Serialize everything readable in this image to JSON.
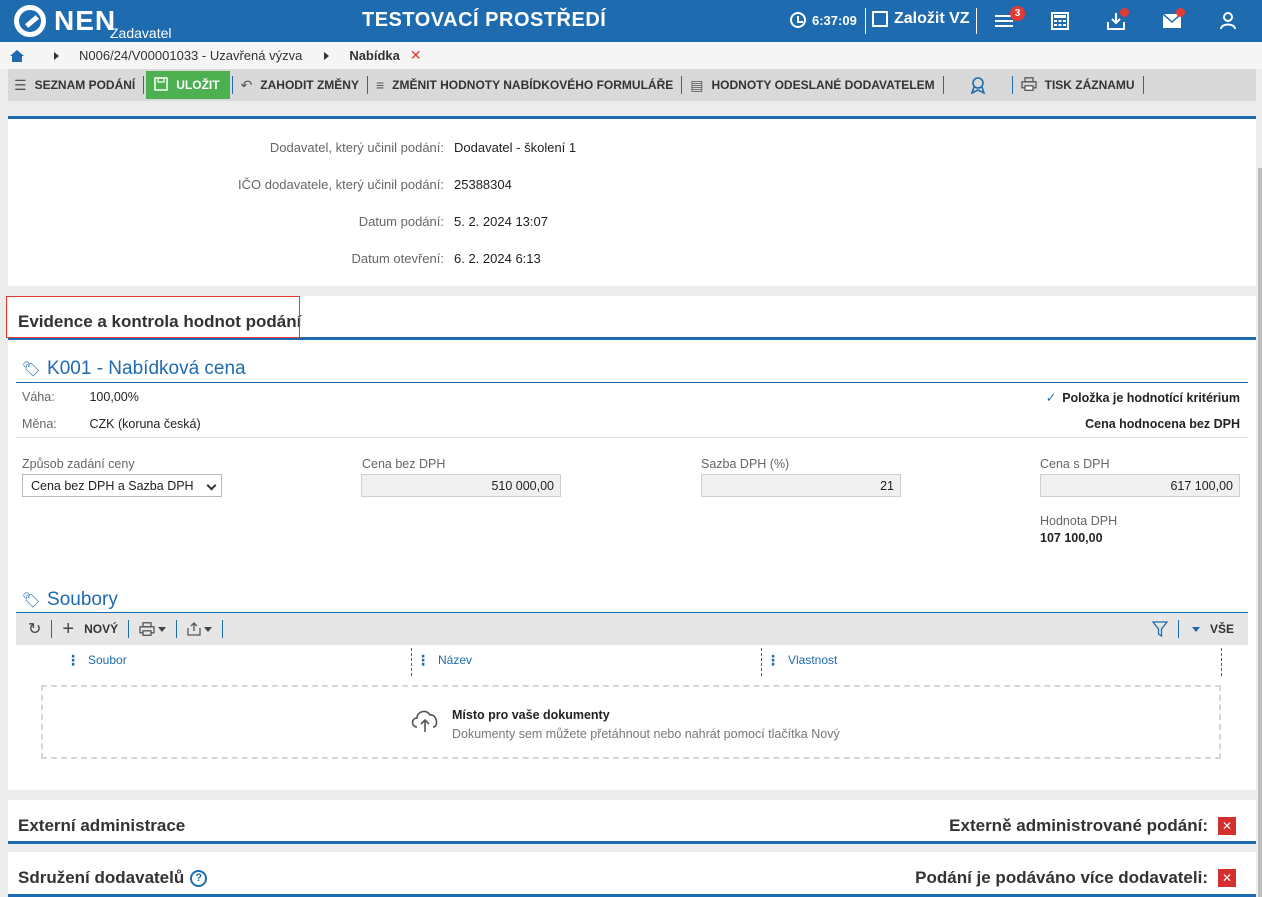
{
  "header": {
    "logo_text": "NEN",
    "logo_sub": "Zadavatel",
    "environment": "TESTOVACÍ PROSTŘEDÍ",
    "time": "6:37:09",
    "create_vz": "Založit VZ",
    "menu_badge": "3",
    "icons": [
      "clock-icon",
      "edit-icon",
      "menu-icon",
      "calculator-icon",
      "inbox-icon",
      "mail-icon",
      "user-icon"
    ]
  },
  "breadcrumb": {
    "items": [
      "N006/24/V00001033 - Uzavřená výzva",
      "Nabídka"
    ]
  },
  "toolbar": {
    "list": "SEZNAM PODÁNÍ",
    "save": "ULOŽIT",
    "discard": "ZAHODIT ZMĚNY",
    "change_values": "ZMĚNIT HODNOTY NABÍDKOVÉHO FORMULÁŘE",
    "sent_values": "HODNOTY ODESLANÉ DODAVATELEM",
    "print": "TISK ZÁZNAMU"
  },
  "info": {
    "rows": [
      {
        "label": "Dodavatel, který učinil podání:",
        "value": "Dodavatel - školení 1"
      },
      {
        "label": "IČO dodavatele, který učinil podání:",
        "value": "25388304"
      },
      {
        "label": "Datum podání:",
        "value": "5. 2. 2024 13:07"
      },
      {
        "label": "Datum otevření:",
        "value": "6. 2. 2024 6:13"
      }
    ]
  },
  "evaluation": {
    "title": "Evidence a kontrola hodnot podání",
    "criterion": {
      "title": "K001 - Nabídková cena",
      "weight_label": "Váha:",
      "weight_value": "100,00%",
      "currency_label": "Měna:",
      "currency_value": "CZK (koruna česká)",
      "is_criterion": "Položka je hodnotící kritérium",
      "evaluated": "Cena hodnocena bez DPH",
      "mode_label": "Způsob zadání ceny",
      "mode_value": "Cena bez DPH a Sazba DPH",
      "price_no_vat_label": "Cena bez DPH",
      "price_no_vat": "510 000,00",
      "vat_rate_label": "Sazba DPH (%)",
      "vat_rate": "21",
      "price_vat_label": "Cena s DPH",
      "price_vat": "617 100,00",
      "vat_amount_label": "Hodnota DPH",
      "vat_amount": "107 100,00"
    },
    "files": {
      "title": "Soubory",
      "new_label": "NOVÝ",
      "all_label": "VŠE",
      "columns": [
        "Soubor",
        "Název",
        "Vlastnost"
      ],
      "dropzone_title": "Místo pro vaše dokumenty",
      "dropzone_sub": "Dokumenty sem můžete přetáhnout nebo nahrát pomocí tlačítka Nový"
    }
  },
  "external": {
    "title": "Externí administrace",
    "flag": "Externě administrované podání:"
  },
  "association": {
    "title": "Sdružení dodavatelů",
    "flag": "Podání je podáváno více dodavateli:"
  },
  "colors": {
    "primary": "#1e6bb0",
    "save": "#4caf50",
    "danger": "#d32f2f"
  }
}
